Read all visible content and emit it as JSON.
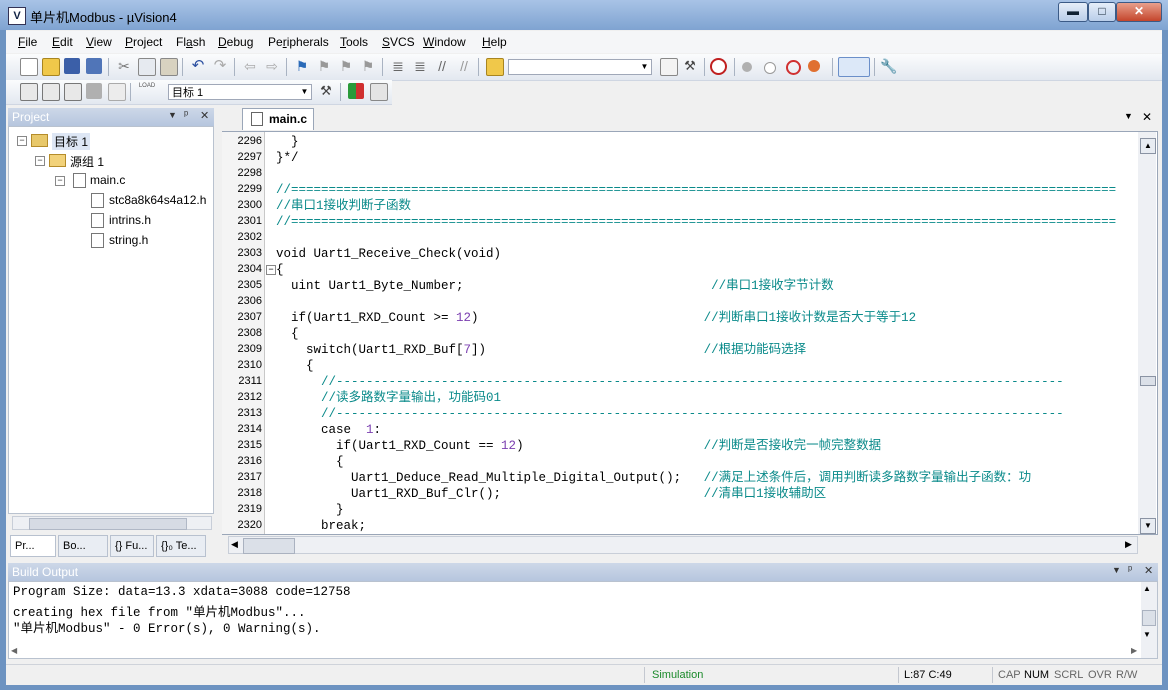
{
  "window": {
    "title": "单片机Modbus  - µVision4",
    "icon_letter": "V",
    "buttons": {
      "minimize": "▬",
      "maximize": "□",
      "close": "✕"
    }
  },
  "menu": [
    "File",
    "Edit",
    "View",
    "Project",
    "Flash",
    "Debug",
    "Peripherals",
    "Tools",
    "SVCS",
    "Window",
    "Help"
  ],
  "menu_mnemonics": [
    "F",
    "E",
    "V",
    "P",
    "a",
    "D",
    "r",
    "T",
    "S",
    "W",
    "H"
  ],
  "toolbar": {
    "find_combo_value": "",
    "target_combo_value": "目标 1",
    "load_label": "LOAD"
  },
  "project_panel": {
    "title": "Project",
    "controls": {
      "dropdown": "▼",
      "pin": "ᵖ",
      "close": "✕"
    },
    "tree": [
      {
        "label": "目标 1",
        "level": 0,
        "type": "target"
      },
      {
        "label": "源组 1",
        "level": 1,
        "type": "folder"
      },
      {
        "label": "main.c",
        "level": 2,
        "type": "file"
      },
      {
        "label": "stc8a8k64s4a12.h",
        "level": 3,
        "type": "header"
      },
      {
        "label": "intrins.h",
        "level": 3,
        "type": "header"
      },
      {
        "label": "string.h",
        "level": 3,
        "type": "header"
      }
    ],
    "tabs": [
      "Pr...",
      "Bo...",
      "{} Fu...",
      "{}₀ Te..."
    ]
  },
  "editor": {
    "tab_label": "main.c",
    "lines": [
      {
        "n": "2296",
        "code": "  }",
        "comment": ""
      },
      {
        "n": "2297",
        "code": "}*/",
        "comment": ""
      },
      {
        "n": "2298",
        "code": "",
        "comment": ""
      },
      {
        "n": "2299",
        "code": "",
        "comment": "//=============================================================================================================="
      },
      {
        "n": "2300",
        "code": "",
        "comment": "//串口1接收判断子函数"
      },
      {
        "n": "2301",
        "code": "",
        "comment": "//=============================================================================================================="
      },
      {
        "n": "2302",
        "code": "",
        "comment": ""
      },
      {
        "n": "2303",
        "code": "void Uart1_Receive_Check(void)",
        "comment": ""
      },
      {
        "n": "2304",
        "code": "{",
        "comment": ""
      },
      {
        "n": "2305",
        "code": "  uint Uart1_Byte_Number;                                 ",
        "comment": "//串口1接收字节计数"
      },
      {
        "n": "2306",
        "code": "",
        "comment": ""
      },
      {
        "n": "2307",
        "code": "  if(Uart1_RXD_Count >= 12)                              ",
        "comment": "//判断串口1接收计数是否大于等于12"
      },
      {
        "n": "2308",
        "code": "  {",
        "comment": ""
      },
      {
        "n": "2309",
        "code": "    switch(Uart1_RXD_Buf[7])                             ",
        "comment": "//根据功能码选择"
      },
      {
        "n": "2310",
        "code": "    {",
        "comment": ""
      },
      {
        "n": "2311",
        "code": "      ",
        "comment": "//-------------------------------------------------------------------------------------------------"
      },
      {
        "n": "2312",
        "code": "      ",
        "comment": "//读多路数字量输出，功能码01"
      },
      {
        "n": "2313",
        "code": "      ",
        "comment": "//-------------------------------------------------------------------------------------------------"
      },
      {
        "n": "2314",
        "code": "      case  1:",
        "comment": ""
      },
      {
        "n": "2315",
        "code": "        if(Uart1_RXD_Count == 12)                        ",
        "comment": "//判断是否接收完一帧完整数据"
      },
      {
        "n": "2316",
        "code": "        {",
        "comment": ""
      },
      {
        "n": "2317",
        "code": "          Uart1_Deduce_Read_Multiple_Digital_Output();   ",
        "comment": "//满足上述条件后，调用判断读多路数字量输出子函数：功"
      },
      {
        "n": "2318",
        "code": "          Uart1_RXD_Buf_Clr();                           ",
        "comment": "//清串口1接收辅助区"
      },
      {
        "n": "2319",
        "code": "        }",
        "comment": ""
      },
      {
        "n": "2320",
        "code": "      break;",
        "comment": ""
      }
    ]
  },
  "build_output": {
    "title": "Build Output",
    "lines": [
      "Program Size: data=13.3 xdata=3088 code=12758",
      "creating hex file from \"单片机Modbus\"...",
      "\"单片机Modbus\" - 0 Error(s), 0 Warning(s)."
    ]
  },
  "status": {
    "mode": "Simulation",
    "position": "L:87 C:49",
    "cap": "CAP",
    "num": "NUM",
    "scrl": "SCRL",
    "ovr": "OVR",
    "rw": "R/W"
  }
}
